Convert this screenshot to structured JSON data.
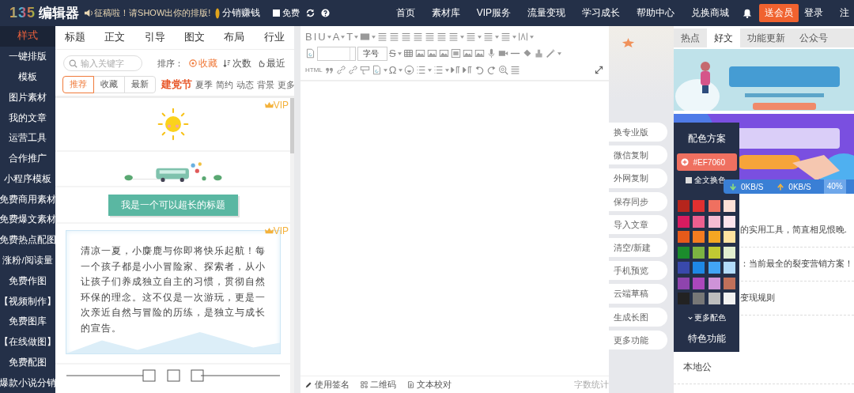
{
  "header": {
    "logo_digits": "135",
    "logo_text": "编辑器",
    "notice": "征稿啦！请SHOW出你的排版!",
    "promo": "分销赚钱",
    "free_toggle": {
      "label": "免费",
      "checked": false
    },
    "nav": [
      {
        "label": "首页"
      },
      {
        "label": "素材库"
      },
      {
        "label": "VIP服务"
      },
      {
        "label": "流量变现"
      },
      {
        "label": "学习成长"
      },
      {
        "label": "帮助中心"
      },
      {
        "label": "兑换商城"
      }
    ],
    "member_button": "送会员",
    "login": "登录",
    "register": "注"
  },
  "sidebar": {
    "items": [
      {
        "label": "样式",
        "selected": true
      },
      {
        "label": "一键排版",
        "selected": false
      },
      {
        "label": "模板",
        "selected": false
      },
      {
        "label": "图片素材",
        "selected": false
      },
      {
        "label": "我的文章",
        "selected": false
      },
      {
        "label": "运营工具",
        "selected": false
      },
      {
        "label": "合作推广",
        "selected": false
      },
      {
        "label": "小程序模板",
        "selected": false
      },
      {
        "label": "免费商用素材",
        "selected": false
      },
      {
        "label": "免费爆文素材",
        "selected": false
      },
      {
        "label": "免费热点配图",
        "selected": false
      },
      {
        "label": "涨粉/阅读量",
        "selected": false
      },
      {
        "label": "免费作图",
        "selected": false
      },
      {
        "label": "【视频制作】",
        "selected": false
      },
      {
        "label": "免费图库",
        "selected": false
      },
      {
        "label": "【在线做图】",
        "selected": false
      },
      {
        "label": "免费配图",
        "selected": false
      },
      {
        "label": "爆款小说分销",
        "selected": false
      }
    ]
  },
  "template_panel": {
    "tabs": [
      {
        "label": "标题"
      },
      {
        "label": "正文"
      },
      {
        "label": "引导"
      },
      {
        "label": "图文"
      },
      {
        "label": "布局"
      },
      {
        "label": "行业"
      }
    ],
    "search": {
      "placeholder": "输入关键字"
    },
    "sort_label": "排序：",
    "sort_options": [
      {
        "label": "收藏",
        "selected": true
      },
      {
        "label": "次数",
        "selected": false
      },
      {
        "label": "最近",
        "selected": false
      }
    ],
    "filters": [
      {
        "label": "推荐",
        "selected": true
      },
      {
        "label": "收藏",
        "selected": false
      },
      {
        "label": "最新",
        "selected": false
      }
    ],
    "tags": [
      {
        "label": "建党节",
        "highlighted": true
      },
      {
        "label": "夏季",
        "highlighted": false
      },
      {
        "label": "简约",
        "highlighted": false
      },
      {
        "label": "动态",
        "highlighted": false
      },
      {
        "label": "背景",
        "highlighted": false
      },
      {
        "label": "更多",
        "highlighted": false
      }
    ],
    "cards": [
      {
        "kind": "sun",
        "vip": "VIP"
      },
      {
        "kind": "bus"
      },
      {
        "kind": "heading",
        "title": "我是一个可以超长的标题"
      },
      {
        "kind": "paragraph",
        "vip": "VIP",
        "text": "清凉一夏，小麋鹿与你即将快乐起航！每一个孩子都是小小冒险家、探索者，从小让孩子们养成独立自主的习惯，贯彻自然环保的理念。这不仅是一次游玩，更是一次亲近自然与冒险的历练，是独立与成长的宣告。"
      },
      {
        "kind": "divider"
      }
    ]
  },
  "editor": {
    "toolbar": {
      "row1": [
        "B",
        "I",
        "U",
        "A",
        "T"
      ],
      "font_size": "字号",
      "row2": [
        "S"
      ],
      "row3": [
        "HTML",
        "Ω"
      ]
    },
    "footer": [
      {
        "kind": "pen",
        "label": "使用签名"
      },
      {
        "kind": "qr",
        "label": "二维码"
      },
      {
        "kind": "doc",
        "label": "文本校对"
      }
    ],
    "word_count": "字数统计"
  },
  "side_tools": [
    {
      "label": "换专业版"
    },
    {
      "label": "微信复制"
    },
    {
      "label": "外网复制"
    },
    {
      "label": "保存同步"
    },
    {
      "label": "导入文章"
    },
    {
      "label": "清空/新建"
    },
    {
      "label": "手机预览"
    },
    {
      "label": "云端草稿"
    },
    {
      "label": "生成长图"
    },
    {
      "label": "更多功能"
    }
  ],
  "right_panel": {
    "tabs": [
      {
        "label": "热点",
        "selected": false
      },
      {
        "label": "好文",
        "selected": true
      },
      {
        "label": "功能更新",
        "selected": false
      },
      {
        "label": "公众号",
        "selected": false
      }
    ],
    "rows": [
      {
        "text": "的实用工具，简直相见恨晚."
      },
      {
        "text": "：当前最全的裂变营销方案！"
      },
      {
        "text": "变现规则"
      },
      {
        "text": "本地公"
      }
    ]
  },
  "color_panel": {
    "title": "配色方案",
    "current": "#EF7060",
    "whole_text": {
      "label": "全文换色",
      "checked": false
    },
    "swatches": [
      {
        "color": "#b5251c"
      },
      {
        "color": "#e03030"
      },
      {
        "color": "#ef7060"
      },
      {
        "color": "#fde0d6"
      },
      {
        "color": "#d81b60"
      },
      {
        "color": "#ec5f8f"
      },
      {
        "color": "#f4bbd3"
      },
      {
        "color": "#fce4ec"
      },
      {
        "color": "#e65a1a"
      },
      {
        "color": "#f57c20"
      },
      {
        "color": "#f5a623"
      },
      {
        "color": "#ffe3a0"
      },
      {
        "color": "#1b8c2c"
      },
      {
        "color": "#7cb342"
      },
      {
        "color": "#c0ca33"
      },
      {
        "color": "#e2efd0"
      },
      {
        "color": "#3949ab"
      },
      {
        "color": "#1e88e5"
      },
      {
        "color": "#42a5f5"
      },
      {
        "color": "#b3dcfa"
      },
      {
        "color": "#8e44ad"
      },
      {
        "color": "#ab47bc"
      },
      {
        "color": "#ce93d8"
      },
      {
        "color": "#c0705a"
      },
      {
        "color": "#222222"
      },
      {
        "color": "#777777"
      },
      {
        "color": "#bdbdbd"
      },
      {
        "color": "#f2f2f2"
      }
    ],
    "more": "更多配色",
    "feature": "特色功能"
  },
  "speed_widget": {
    "down": "0KB/S",
    "up": "0KB/S",
    "percent": "40%"
  }
}
